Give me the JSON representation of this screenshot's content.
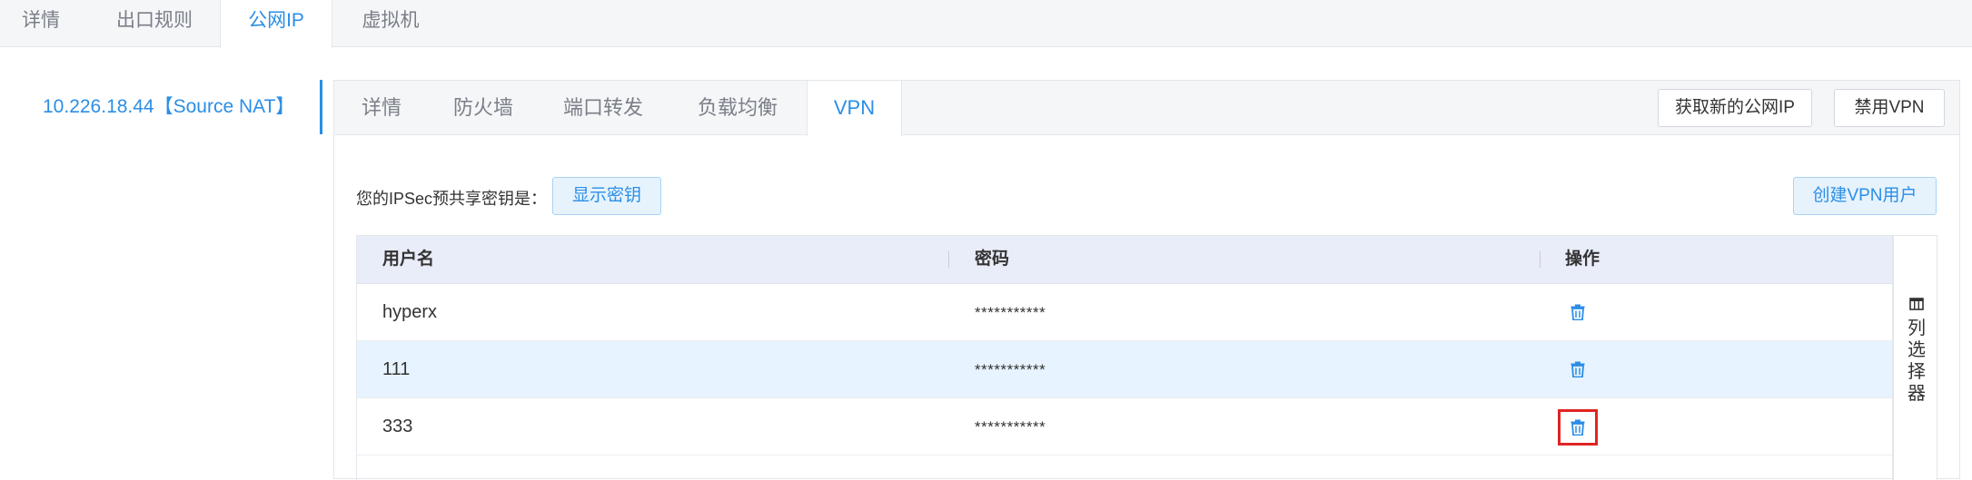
{
  "top_tabs": [
    "详情",
    "出口规则",
    "公网IP",
    "虚拟机"
  ],
  "top_tab_active": "公网IP",
  "ip_list": {
    "selected": "10.226.18.44【Source NAT】"
  },
  "inner_tabs": [
    "详情",
    "防火墙",
    "端口转发",
    "负载均衡",
    "VPN"
  ],
  "inner_tab_active": "VPN",
  "actions": {
    "acquire_ip": "获取新的公网IP",
    "disable_vpn": "禁用VPN"
  },
  "psk": {
    "label": "您的IPSec预共享密钥是：",
    "show_button": "显示密钥"
  },
  "create_user_button": "创建VPN用户",
  "table": {
    "columns": [
      "用户名",
      "密码",
      "操作"
    ],
    "rows": [
      {
        "username": "hyperx",
        "password": "***********",
        "action_icon": "trash-icon"
      },
      {
        "username": "111",
        "password": "***********",
        "action_icon": "trash-icon"
      },
      {
        "username": "333",
        "password": "***********",
        "action_icon": "trash-icon"
      }
    ]
  },
  "column_picker": {
    "icon": "columns-icon",
    "label": "列选择器"
  },
  "colors": {
    "accent": "#2b8ee6",
    "header_bg": "#e9ecf9",
    "alt_row_bg": "#e7f3fe",
    "highlight": "#e02424"
  }
}
